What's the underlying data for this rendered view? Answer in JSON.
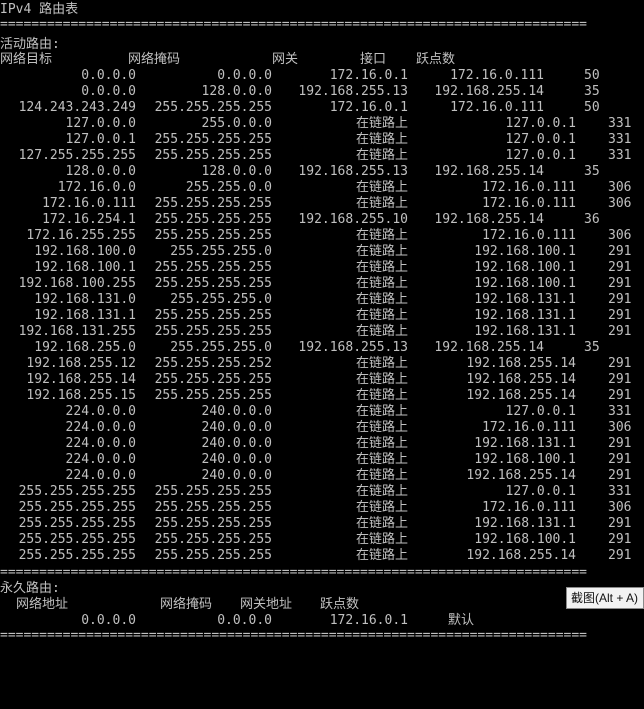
{
  "title": "IPv4 路由表",
  "separator": "===========================================================================",
  "active": {
    "heading": "活动路由:",
    "headers": [
      "网络目标",
      "网络掩码",
      "网关",
      "接口",
      "跃点数"
    ],
    "rows": [
      [
        "0.0.0.0",
        "0.0.0.0",
        "172.16.0.1",
        "172.16.0.111",
        "50"
      ],
      [
        "0.0.0.0",
        "128.0.0.0",
        "192.168.255.13",
        "192.168.255.14",
        "35"
      ],
      [
        "124.243.243.249",
        "255.255.255.255",
        "172.16.0.1",
        "172.16.0.111",
        "50"
      ],
      [
        "127.0.0.0",
        "255.0.0.0",
        "在链路上",
        "127.0.0.1",
        "331"
      ],
      [
        "127.0.0.1",
        "255.255.255.255",
        "在链路上",
        "127.0.0.1",
        "331"
      ],
      [
        "127.255.255.255",
        "255.255.255.255",
        "在链路上",
        "127.0.0.1",
        "331"
      ],
      [
        "128.0.0.0",
        "128.0.0.0",
        "192.168.255.13",
        "192.168.255.14",
        "35"
      ],
      [
        "172.16.0.0",
        "255.255.0.0",
        "在链路上",
        "172.16.0.111",
        "306"
      ],
      [
        "172.16.0.111",
        "255.255.255.255",
        "在链路上",
        "172.16.0.111",
        "306"
      ],
      [
        "172.16.254.1",
        "255.255.255.255",
        "192.168.255.10",
        "192.168.255.14",
        "36"
      ],
      [
        "172.16.255.255",
        "255.255.255.255",
        "在链路上",
        "172.16.0.111",
        "306"
      ],
      [
        "192.168.100.0",
        "255.255.255.0",
        "在链路上",
        "192.168.100.1",
        "291"
      ],
      [
        "192.168.100.1",
        "255.255.255.255",
        "在链路上",
        "192.168.100.1",
        "291"
      ],
      [
        "192.168.100.255",
        "255.255.255.255",
        "在链路上",
        "192.168.100.1",
        "291"
      ],
      [
        "192.168.131.0",
        "255.255.255.0",
        "在链路上",
        "192.168.131.1",
        "291"
      ],
      [
        "192.168.131.1",
        "255.255.255.255",
        "在链路上",
        "192.168.131.1",
        "291"
      ],
      [
        "192.168.131.255",
        "255.255.255.255",
        "在链路上",
        "192.168.131.1",
        "291"
      ],
      [
        "192.168.255.0",
        "255.255.255.0",
        "192.168.255.13",
        "192.168.255.14",
        "35"
      ],
      [
        "192.168.255.12",
        "255.255.255.252",
        "在链路上",
        "192.168.255.14",
        "291"
      ],
      [
        "192.168.255.14",
        "255.255.255.255",
        "在链路上",
        "192.168.255.14",
        "291"
      ],
      [
        "192.168.255.15",
        "255.255.255.255",
        "在链路上",
        "192.168.255.14",
        "291"
      ],
      [
        "224.0.0.0",
        "240.0.0.0",
        "在链路上",
        "127.0.0.1",
        "331"
      ],
      [
        "224.0.0.0",
        "240.0.0.0",
        "在链路上",
        "172.16.0.111",
        "306"
      ],
      [
        "224.0.0.0",
        "240.0.0.0",
        "在链路上",
        "192.168.131.1",
        "291"
      ],
      [
        "224.0.0.0",
        "240.0.0.0",
        "在链路上",
        "192.168.100.1",
        "291"
      ],
      [
        "224.0.0.0",
        "240.0.0.0",
        "在链路上",
        "192.168.255.14",
        "291"
      ],
      [
        "255.255.255.255",
        "255.255.255.255",
        "在链路上",
        "127.0.0.1",
        "331"
      ],
      [
        "255.255.255.255",
        "255.255.255.255",
        "在链路上",
        "172.16.0.111",
        "306"
      ],
      [
        "255.255.255.255",
        "255.255.255.255",
        "在链路上",
        "192.168.131.1",
        "291"
      ],
      [
        "255.255.255.255",
        "255.255.255.255",
        "在链路上",
        "192.168.100.1",
        "291"
      ],
      [
        "255.255.255.255",
        "255.255.255.255",
        "在链路上",
        "192.168.255.14",
        "291"
      ]
    ]
  },
  "persistent": {
    "heading": "永久路由:",
    "headers": [
      "网络地址",
      "网络掩码",
      "网关地址",
      "跃点数"
    ],
    "rows": [
      [
        "0.0.0.0",
        "0.0.0.0",
        "172.16.0.1",
        "默认"
      ]
    ]
  },
  "tooltip": "截图(Alt + A)"
}
